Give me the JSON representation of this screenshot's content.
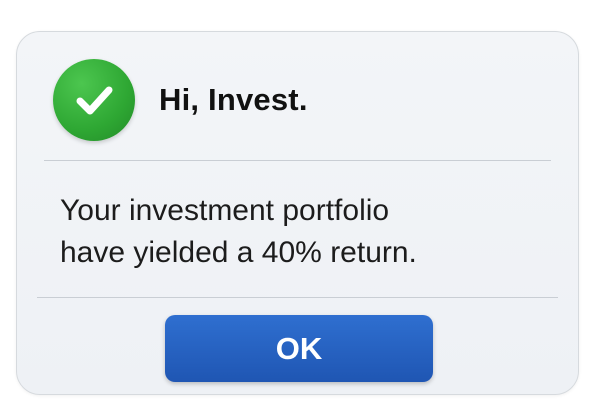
{
  "dialog": {
    "title": "Hi, Invest.",
    "icon": "check-circle-icon",
    "message_line1": "Your investment portfolio",
    "message_line2": "have yielded a 40% return.",
    "ok_label": "OK"
  },
  "colors": {
    "success_green": "#2ea733",
    "button_blue": "#2563c4",
    "dialog_background": "#f1f3f6"
  }
}
